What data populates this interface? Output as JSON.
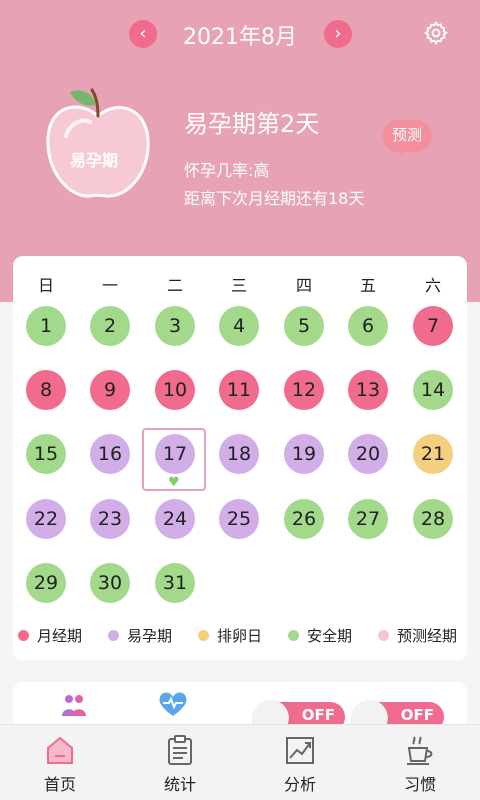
{
  "header": {
    "prev_icon": "chevron-left-icon",
    "next_icon": "chevron-right-icon",
    "month_title": "2021年8月",
    "settings_icon": "gear-icon",
    "apple_label": "易孕期",
    "phase_title": "易孕期第2天",
    "predict_label": "预测",
    "probability": "怀孕几率:高",
    "next_period": "距离下次月经期还有18天",
    "bg_color": "#e7a3b5"
  },
  "calendar": {
    "weekdays": [
      "日",
      "一",
      "二",
      "三",
      "四",
      "五",
      "六"
    ],
    "selected_day": "17",
    "days": [
      "1",
      "2",
      "3",
      "4",
      "5",
      "6",
      "7",
      "8",
      "9",
      "10",
      "11",
      "12",
      "13",
      "14",
      "15",
      "16",
      "17",
      "18",
      "19",
      "20",
      "21",
      "22",
      "23",
      "24",
      "25",
      "26",
      "27",
      "28",
      "29",
      "30",
      "31"
    ],
    "day_types": [
      "safe",
      "safe",
      "safe",
      "safe",
      "safe",
      "safe",
      "period",
      "period",
      "period",
      "period",
      "period",
      "period",
      "period",
      "safe",
      "safe",
      "fertile",
      "fertile",
      "fertile",
      "fertile",
      "fertile",
      "ovulation",
      "fertile",
      "fertile",
      "fertile",
      "fertile",
      "safe",
      "safe",
      "safe",
      "safe",
      "safe",
      "safe"
    ],
    "colors": {
      "period": "#f06b8d",
      "fertile": "#d2aee8",
      "ovulation": "#f3cf7f",
      "safe": "#a3d98b",
      "predicted_period": "#f7c6d6"
    }
  },
  "legend": [
    {
      "label": "月经期",
      "color": "#f06b8d"
    },
    {
      "label": "易孕期",
      "color": "#d2aee8"
    },
    {
      "label": "排卵日",
      "color": "#f3cf7f"
    },
    {
      "label": "安全期",
      "color": "#a3d98b"
    },
    {
      "label": "预测经期",
      "color": "#f7c6d6"
    }
  ],
  "quick_panel": {
    "icons": [
      "couple-icon",
      "heart-pulse-icon"
    ],
    "toggle1_label": "OFF",
    "toggle2_label": "OFF"
  },
  "tabs": [
    {
      "label": "首页",
      "icon": "home-icon"
    },
    {
      "label": "统计",
      "icon": "clipboard-icon"
    },
    {
      "label": "分析",
      "icon": "chart-icon"
    },
    {
      "label": "习惯",
      "icon": "cup-icon"
    }
  ]
}
